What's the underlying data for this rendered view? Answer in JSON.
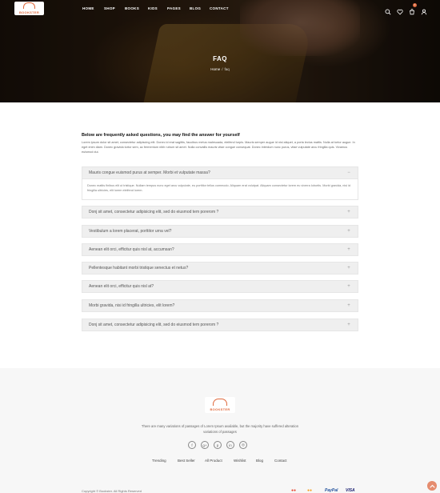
{
  "brand": {
    "logo_text": "BOOKSTER"
  },
  "nav": {
    "items": [
      "HOME",
      "SHOP",
      "BOOKS",
      "KIDS",
      "PAGES",
      "BLOG",
      "CONTACT"
    ]
  },
  "header_icons": {
    "search": "search-icon",
    "wishlist": "heart-icon",
    "cart": "cart-icon",
    "cart_count": "0",
    "account": "user-icon"
  },
  "hero": {
    "title": "FAQ",
    "breadcrumb": {
      "home": "Home",
      "separator": "/",
      "current": "faq"
    }
  },
  "intro": {
    "title": "Below are frequently asked questions, you may find the answer for yourself",
    "text": "Lorem ipsum dolor sit amet, consectetur adipiscing elit. Donec id erat sagittis, faucibus metus malesuada, eleifend turpis. Mauris semper augue id nisl aliquet, a porta lectus mattis. Nulla at tortor augue. In eget enim diam. Donec gravida tortor sem, ac fermentum nibh rutrum sit amet. Nulla convallis mauris vitae congue consequat. Donec interdum nunc purus, vitae vulputate arcu fringilla quis. Vivamus euismod dui."
  },
  "faq": {
    "items": [
      {
        "question": "Mauris congue euismod purus at semper. Morbi et vulputate massa?",
        "toggle": "−",
        "open": true,
        "answer": "Donec mattis finibus elit ut tristique. Nullam tempus nunc eget arcu vulputate, eu porttitor tellus commodo. Aliquam erat volutpat. Aliquam consectetur lorem eu viverra lobortis. Morbi gravida, nisi id fringilla ultricies, elit lorem eleifend lorem."
      },
      {
        "question": "Donj sit amet, consectetur adipisicing elit, sed do eiusmod tem porerom ?",
        "toggle": "+",
        "open": false
      },
      {
        "question": "Vestibulum a lorem placerat, porttitor urna vel?",
        "toggle": "+",
        "open": false
      },
      {
        "question": "Aenean elit orci, efficitur quis nisl at, accumsan?",
        "toggle": "+",
        "open": false
      },
      {
        "question": "Pellentesque habitant morbi tristique senectus et netus?",
        "toggle": "+",
        "open": false
      },
      {
        "question": "Aenean elit orci, efficitur quis nisl at?",
        "toggle": "+",
        "open": false
      },
      {
        "question": "Morbi gravida, nisi id fringilla ultricies, elit lorem?",
        "toggle": "+",
        "open": false
      },
      {
        "question": "Donj sit amet, consectetur adipisicing elit, sed do eiusmod tem porerom ?",
        "toggle": "+",
        "open": false
      }
    ]
  },
  "footer": {
    "logo_text": "BOOKSTER",
    "description": "There are many variations of passages of Lorem Ipsum available, but the majority have suffered alteration variations of passages",
    "socials": [
      {
        "icon": "facebook-icon",
        "glyph": "f"
      },
      {
        "icon": "google-plus-icon",
        "glyph": "g+"
      },
      {
        "icon": "pinterest-icon",
        "glyph": "p"
      },
      {
        "icon": "linkedin-icon",
        "glyph": "in"
      },
      {
        "icon": "instagram-icon",
        "glyph": "◎"
      }
    ],
    "links": [
      "Trending",
      "Best Seller",
      "All Product",
      "Wishlist",
      "Blog",
      "Contact"
    ],
    "copyright": "Copyright © Bookster. All Rights Reserved",
    "payments": [
      "mastercard-icon",
      "mastercard-icon",
      "paypal-icon",
      "visa-icon"
    ],
    "payment_labels": [
      "●●",
      "●●",
      "PayPal",
      "VISA"
    ],
    "payment_colors": [
      "#e8412c",
      "#f59e1b",
      "#1f4f9c",
      "#1a1f71"
    ]
  },
  "colors": {
    "accent": "#e06b3f",
    "back_to_top": "#e58c6e"
  }
}
